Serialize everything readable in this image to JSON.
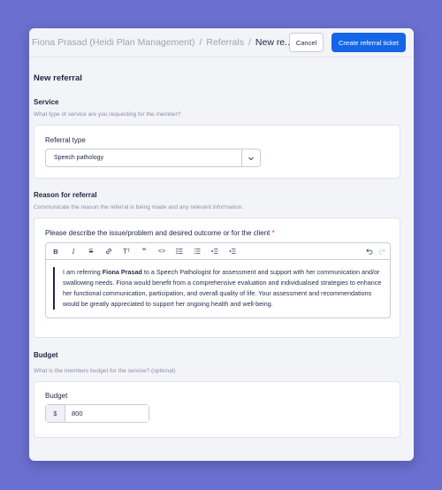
{
  "breadcrumb": {
    "items": [
      "Fiona Prasad (Heidi Plan Management)",
      "Referrals",
      "New re..."
    ],
    "separator": "/"
  },
  "header": {
    "cancel_label": "Cancel",
    "create_label": "Create referral ticket"
  },
  "page": {
    "title": "New referral"
  },
  "service": {
    "title": "Service",
    "description": "What type of service are you requesting for the member?",
    "referral_type_label": "Referral type",
    "referral_type_value": "Speech pathology"
  },
  "reason": {
    "title": "Reason for referral",
    "description": "Communicate the reason the referral is being made and any relevant information.",
    "field_label": "Please describe the issue/problem and desired outcome or for the client",
    "required_marker": "*",
    "text_before": "I am referring ",
    "text_bold": "Fiona Prasad",
    "text_after": " to a Speech Pathologist for assessment and support with her communication and/or swallowing needs. Fiona would benefit from a comprehensive evaluation and individualised strategies to enhance her functional communication, participation, and overall quality of life. Your assessment and recommendations would be greatly appreciated to support her ongoing health and well-being.",
    "toolbar": [
      "bold-icon",
      "italic-icon",
      "strikethrough-icon",
      "link-icon",
      "text-size-icon",
      "quote-icon",
      "code-icon",
      "bullet-list-icon",
      "numbered-list-icon",
      "outdent-icon",
      "indent-icon",
      "undo-icon",
      "redo-icon"
    ]
  },
  "budget": {
    "title": "Budget",
    "description": "What is the members budget for the service? (optional)",
    "field_label": "Budget",
    "currency": "$",
    "value": "800"
  },
  "colors": {
    "accent": "#1565e8",
    "background": "#6b6fcf",
    "required": "#d6334a"
  }
}
